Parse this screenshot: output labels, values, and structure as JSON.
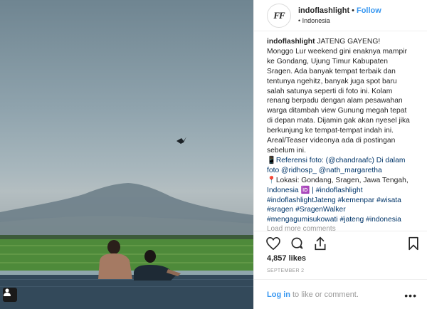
{
  "post": {
    "username": "indoflashlight",
    "follow_label": "Follow",
    "separator": "•",
    "location": "Indonesia",
    "location_dot": "•",
    "avatar_logo": "FF"
  },
  "caption": {
    "user": "indoflashlight",
    "lines": [
      " JATENG GAYENG!",
      "Monggo Lur weekend gini enaknya mampir",
      "ke Gondang, Ujung Timur Kabupaten",
      "Sragen. Ada banyak tempat terbaik dan",
      "tentunya ngehitz, banyak juga spot baru",
      "salah satunya seperti di foto ini. Kolam",
      "renang berpadu dengan alam pesawahan",
      "warga ditambah view Gunung megah tepat",
      "di depan mata. Dijamin gak akan nyesel jika",
      "berkunjung ke tempat-tempat indah ini.",
      "Areal/Teaser videonya ada di postingan",
      "sebelum ini.",
      "📱Referensi foto: (@chandraafc) Di dalam",
      "foto @ridhosp_ @nath_margaretha",
      "📍Lokasi: Gondang, Sragen, Jawa Tengah,",
      "Indonesia 🆔 | #indoflashlight",
      "#indoflashlightJateng #kemenpar #wisata",
      "#sragen #SragenWalker",
      "#mengagumisukowati #jateng #indonesia"
    ],
    "load_more": "Load more comments"
  },
  "actions": {
    "like_icon": "heart-icon",
    "comment_icon": "comment-icon",
    "share_icon": "share-icon",
    "save_icon": "bookmark-icon"
  },
  "likes": "4,857 likes",
  "date": "SEPTEMBER 2",
  "footer": {
    "login": "Log in",
    "rest": "to like or comment.",
    "more": "•••"
  },
  "colors": {
    "link": "#3897f0",
    "hashtag": "#003569"
  }
}
